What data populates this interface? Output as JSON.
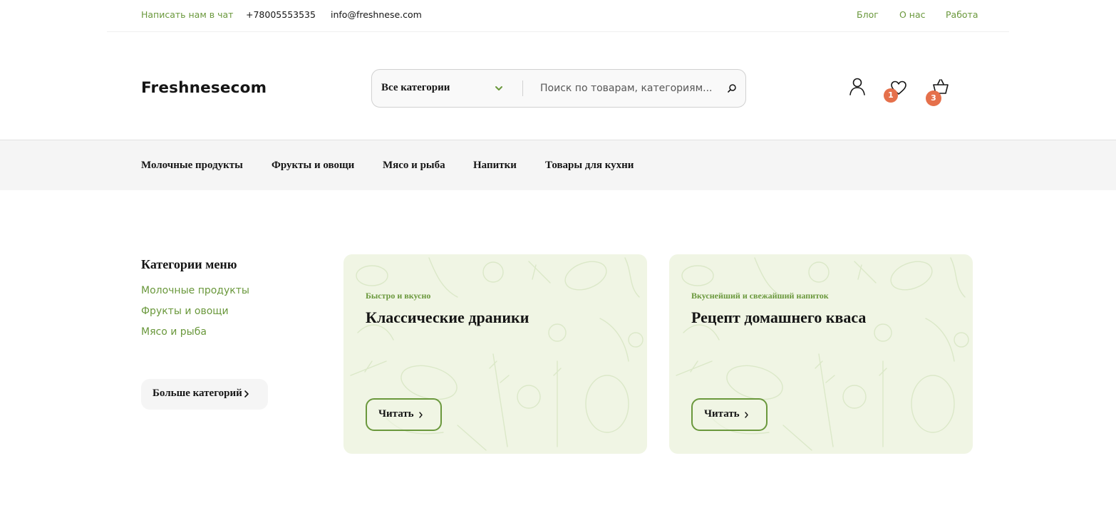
{
  "topbar": {
    "chat": "Написать нам в чат",
    "phone": "+78005553535",
    "email": "info@freshnese.com",
    "links": [
      "Блог",
      "О нас",
      "Работа"
    ]
  },
  "header": {
    "logo": "Freshnesecom",
    "search": {
      "category": "Все категории",
      "placeholder": "Поиск по товарам, категориям...",
      "icons": {
        "dropdown": "chevron-down-icon",
        "submit": "search-icon"
      }
    },
    "actions": {
      "user_icon": "user-icon",
      "wishlist_icon": "heart-icon",
      "wishlist_count": "1",
      "cart_icon": "basket-icon",
      "cart_count": "3"
    }
  },
  "nav": {
    "items": [
      "Молочные продукты",
      "Фрукты и овощи",
      "Мясо и рыба",
      "Напитки",
      "Товары для кухни"
    ]
  },
  "sidebar": {
    "title": "Категории меню",
    "items": [
      "Молочные продукты",
      "Фрукты и овощи",
      "Мясо и рыба"
    ],
    "more_label": "Больше категорий"
  },
  "cards": [
    {
      "kicker": "Быстро и вкусно",
      "title": "Классические драники",
      "button": "Читать"
    },
    {
      "kicker": "Вкуснейший и свежайший напиток",
      "title": "Рецепт домашнего кваса",
      "button": "Читать"
    }
  ],
  "colors": {
    "accent": "#6a983c",
    "badge": "#e5704b",
    "card_bg": "#f0f5e4",
    "nav_bg": "#f5f5f5",
    "text": "#151515"
  }
}
